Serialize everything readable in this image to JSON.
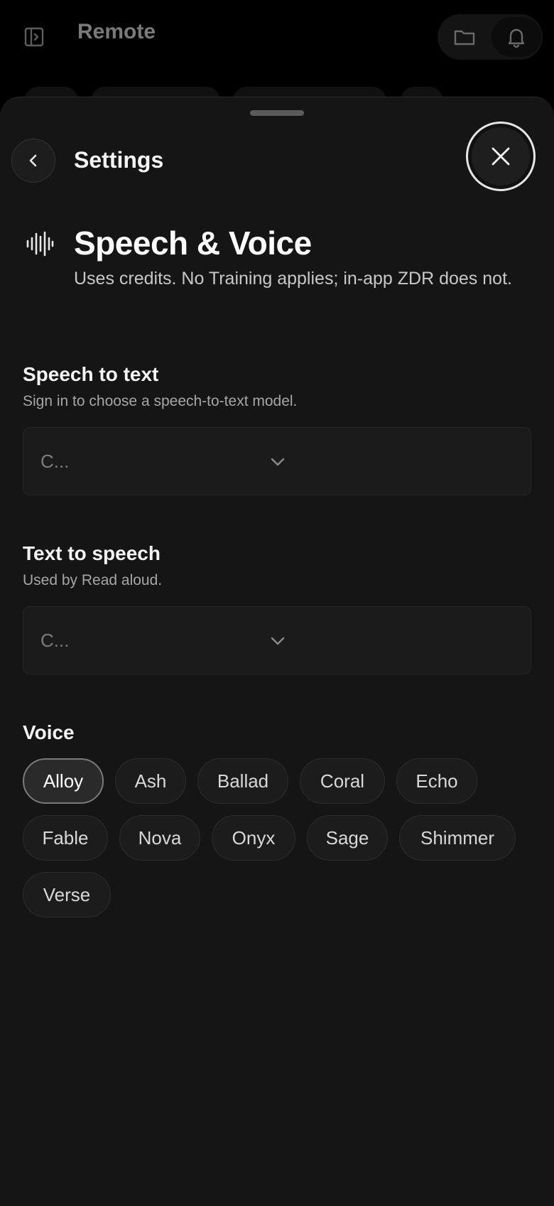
{
  "background": {
    "title": "Remote",
    "icons": {
      "sidebar": "sidebar-toggle-icon",
      "folder": "folder-icon",
      "bell": "bell-icon"
    }
  },
  "sheet": {
    "title": "Settings",
    "back_icon": "chevron-left-icon",
    "close_icon": "close-icon"
  },
  "section": {
    "icon": "waveform-icon",
    "title": "Speech & Voice",
    "description": "Uses credits. No Training applies; in-app ZDR does not."
  },
  "speech_to_text": {
    "title": "Speech to text",
    "subtitle": "Sign in to choose a speech-to-text model.",
    "value": "C..."
  },
  "text_to_speech": {
    "title": "Text to speech",
    "subtitle": "Used by Read aloud.",
    "value": "C..."
  },
  "voice": {
    "title": "Voice",
    "selected": "Alloy",
    "options": [
      "Alloy",
      "Ash",
      "Ballad",
      "Coral",
      "Echo",
      "Fable",
      "Nova",
      "Onyx",
      "Sage",
      "Shimmer",
      "Verse"
    ]
  },
  "colors": {
    "sheet_bg": "#151515",
    "chip_bg": "#1c1c1c",
    "selected_border": "#7a7a7a"
  }
}
